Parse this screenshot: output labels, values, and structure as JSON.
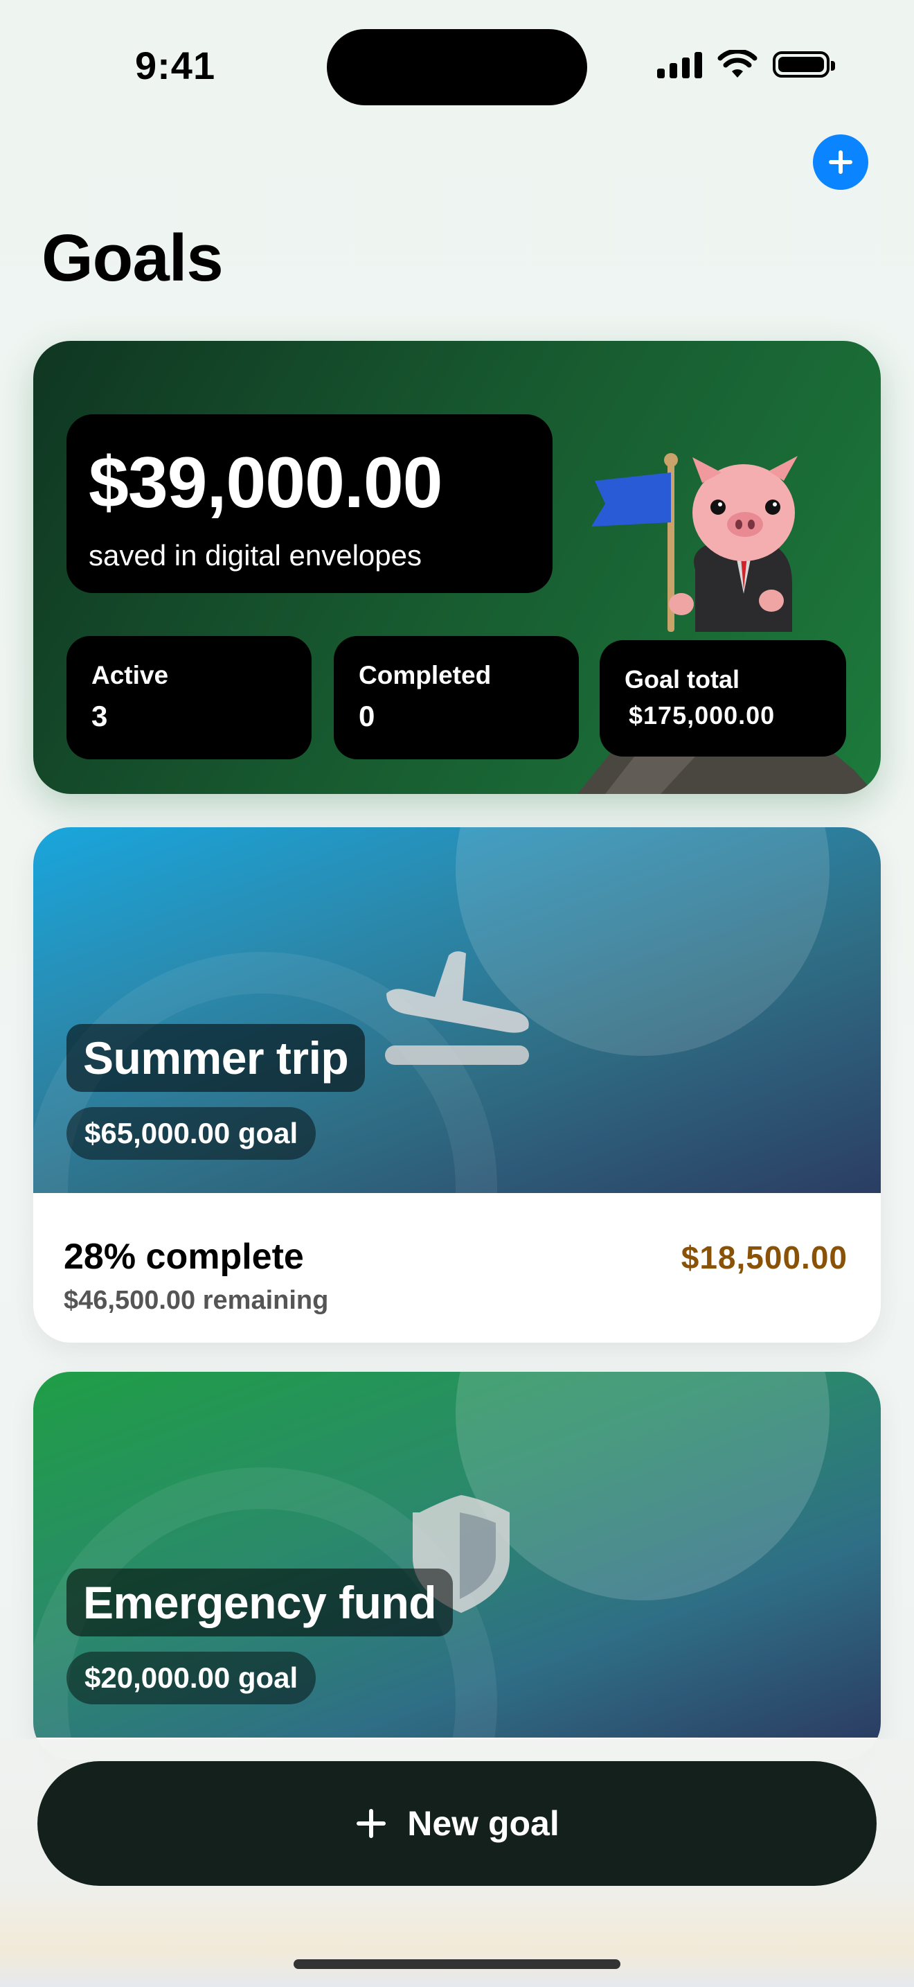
{
  "status_bar": {
    "time": "9:41"
  },
  "header": {
    "title": "Goals"
  },
  "summary": {
    "saved_amount": "$39,000.00",
    "saved_caption": "saved in digital envelopes",
    "active_label": "Active",
    "active_value": "3",
    "completed_label": "Completed",
    "completed_value": "0",
    "total_label": "Goal total",
    "total_value": "$175,000.00"
  },
  "goals": [
    {
      "name": "Summer trip",
      "target": "$65,000.00 goal",
      "icon": "airplane-icon",
      "progress_text": "28% complete",
      "remaining": "$46,500.00 remaining",
      "saved": "$18,500.00"
    },
    {
      "name": "Emergency fund",
      "target": "$20,000.00 goal",
      "icon": "shield-icon"
    }
  ],
  "actions": {
    "new_goal_label": "New goal"
  },
  "colors": {
    "accent": "#0a84ff",
    "saved_amount": "#8a5206",
    "summary_green": "#1d7a3c"
  }
}
